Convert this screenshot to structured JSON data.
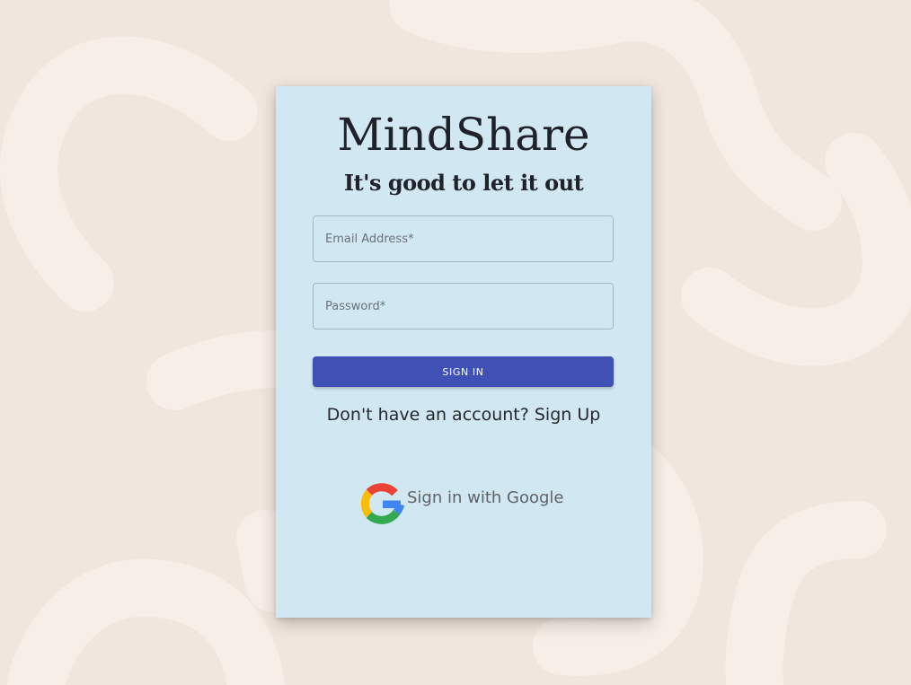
{
  "app": {
    "title": "MindShare",
    "tagline": "It's good to let it out"
  },
  "form": {
    "email_placeholder": "Email Address*",
    "email_value": "",
    "password_placeholder": "Password*",
    "password_value": "",
    "signin_label": "SIGN IN",
    "signup_prompt": "Don't have an account? Sign Up"
  },
  "oauth": {
    "google_label": "Sign in with Google",
    "google_icon": "google-g-icon"
  },
  "colors": {
    "background": "#f1e6dd",
    "background_shapes": "#f7eee7",
    "card": "#d1e7f1",
    "primary_button": "#3f51b5",
    "text": "#20222b"
  }
}
